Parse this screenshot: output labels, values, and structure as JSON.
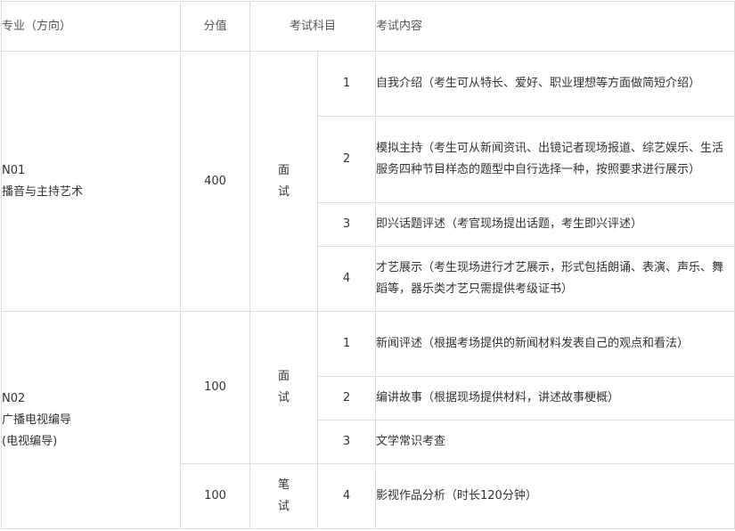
{
  "headers": {
    "major": "专业（方向）",
    "score": "分值",
    "subject": "考试科目",
    "content": "考试内容"
  },
  "groups": [
    {
      "code": "N01",
      "name_lines": [
        "播音与主持艺术"
      ],
      "score": "400",
      "subject_chars": [
        "面",
        "试"
      ],
      "items": [
        {
          "num": "1",
          "text": "自我介绍（考生可从特长、爱好、职业理想等方面做简短介绍）"
        },
        {
          "num": "2",
          "text": "模拟主持（考生可从新闻资讯、出镜记者现场报道、综艺娱乐、生活服务四种节目样态的题型中自行选择一种，按照要求进行展示）"
        },
        {
          "num": "3",
          "text": "即兴话题评述（考官现场提出话题，考生即兴评述）"
        },
        {
          "num": "4",
          "text": "才艺展示（考生现场进行才艺展示，形式包括朗诵、表演、声乐、舞蹈等，器乐类才艺只需提供考级证书）"
        }
      ]
    },
    {
      "code": "N02",
      "name_lines": [
        "广播电视编导",
        "(电视编导)"
      ],
      "score": "100",
      "subject_chars": [
        "面",
        "试"
      ],
      "items": [
        {
          "num": "1",
          "text": "新闻评述（根据考场提供的新闻材料发表自己的观点和看法）"
        },
        {
          "num": "2",
          "text": "编讲故事（根据现场提供材料，讲述故事梗概）"
        },
        {
          "num": "3",
          "text": "文学常识考查"
        }
      ],
      "written": {
        "score": "100",
        "subject_chars": [
          "笔",
          "试"
        ],
        "num": "4",
        "text": "影视作品分析（时长120分钟）"
      }
    }
  ]
}
